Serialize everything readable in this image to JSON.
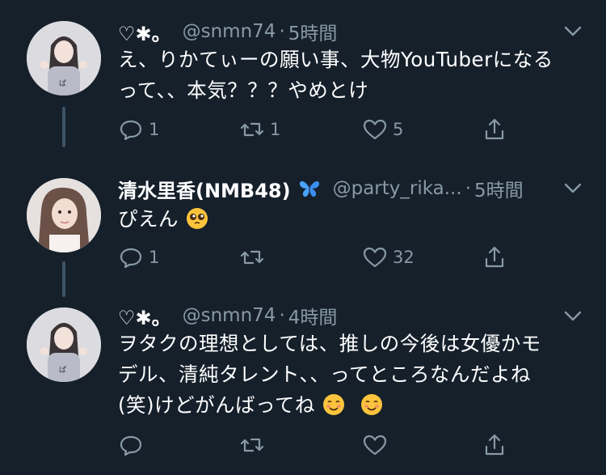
{
  "tweets": [
    {
      "name": "♡✱。",
      "handle": "@snmn74",
      "time": "5時間",
      "text": "え、りかてぃーの願い事、大物YouTuberになるって、、本気？？？やめとけ",
      "line1": "え、りかてぃーの願い事、大物YouTuberになる",
      "line2": "って、、本気？？？やめとけ",
      "replies": "1",
      "retweets": "1",
      "likes": "5"
    },
    {
      "name": "清水里香(NMB48)",
      "handle": "@party_rika...",
      "time": "5時間",
      "text": "ぴえん",
      "replies": "1",
      "retweets": "",
      "likes": "32",
      "badge_icon": "blue-butterfly-icon",
      "emoji_icon": "pleading-face-emoji"
    },
    {
      "name": "♡✱。",
      "handle": "@snmn74",
      "time": "4時間",
      "line1": "ヲタクの理想としては、推しの今後は女優かモ",
      "line2": "デル、清純タレント、、ってところなんだよね",
      "line3": "(笑)けどがんばってね",
      "replies": "",
      "retweets": "",
      "likes": "",
      "emoji_icon": "smiling-face-emoji"
    }
  ],
  "dot": "·",
  "colors": {
    "background": "#15202b",
    "text": "#ffffff",
    "muted": "#8899a6",
    "thread_line": "#3d5466",
    "butterfly": "#4aa3ff"
  }
}
